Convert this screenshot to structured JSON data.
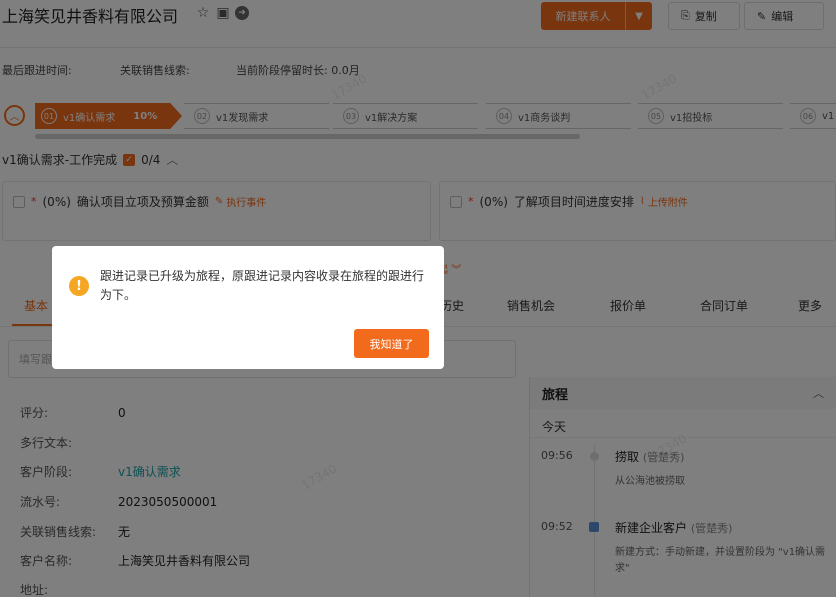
{
  "header": {
    "title": "上海笑见井香料有限公司",
    "new_contact_label": "新建联系人",
    "copy_label": "复制",
    "edit_label": "编辑"
  },
  "meta": {
    "last_followup_label": "最后跟进时间:",
    "related_lead_label": "关联销售线索:",
    "stage_duration_label": "当前阶段停留时长:",
    "stage_duration_value": "0.0月"
  },
  "stages": [
    {
      "num": "01",
      "label": "v1确认需求",
      "percent": "10%"
    },
    {
      "num": "02",
      "label": "v1发现需求"
    },
    {
      "num": "03",
      "label": "v1解决方案"
    },
    {
      "num": "04",
      "label": "v1商务谈判"
    },
    {
      "num": "05",
      "label": "v1招投标"
    },
    {
      "num": "06",
      "label": "v1"
    }
  ],
  "tasks": {
    "heading": "v1确认需求-工作完成",
    "count": "0/4",
    "items": [
      {
        "percent": "(0%)",
        "text": "确认项目立项及预算金额",
        "action": "执行事件"
      },
      {
        "percent": "(0%)",
        "text": "了解项目时间进度安排",
        "action": "上传附件"
      }
    ],
    "collapse_label": "起"
  },
  "tabs": [
    {
      "label": "基本"
    },
    {
      "label": "历史"
    },
    {
      "label": "销售机会"
    },
    {
      "label": "报价单"
    },
    {
      "label": "合同订单"
    },
    {
      "label": "更多"
    }
  ],
  "search": {
    "placeholder": "填写跟"
  },
  "fields": [
    {
      "label": "评分:",
      "value": "0"
    },
    {
      "label": "多行文本:",
      "value": ""
    },
    {
      "label": "客户阶段:",
      "value": "v1确认需求"
    },
    {
      "label": "流水号:",
      "value": "2023050500001"
    },
    {
      "label": "关联销售线索:",
      "value": "无"
    },
    {
      "label": "客户名称:",
      "value": "上海笑见井香料有限公司"
    },
    {
      "label": "地址:",
      "value": ""
    }
  ],
  "journey": {
    "title": "旅程",
    "today": "今天",
    "events": [
      {
        "time": "09:56",
        "title": "捞取",
        "who": "(管楚秀)",
        "desc": "从公海池被捞取"
      },
      {
        "time": "09:52",
        "title": "新建企业客户",
        "who": "(管楚秀)",
        "desc": "新建方式：手动新建，并设置阶段为 \"v1确认需求\""
      }
    ]
  },
  "modal": {
    "message": "跟进记录已升级为旅程，原跟进记录内容收录在旅程的跟进行为下。",
    "ok_label": "我知道了"
  },
  "colors": {
    "accent": "#f26a1b",
    "link": "#1aa0a6",
    "warning": "#f5a623"
  }
}
